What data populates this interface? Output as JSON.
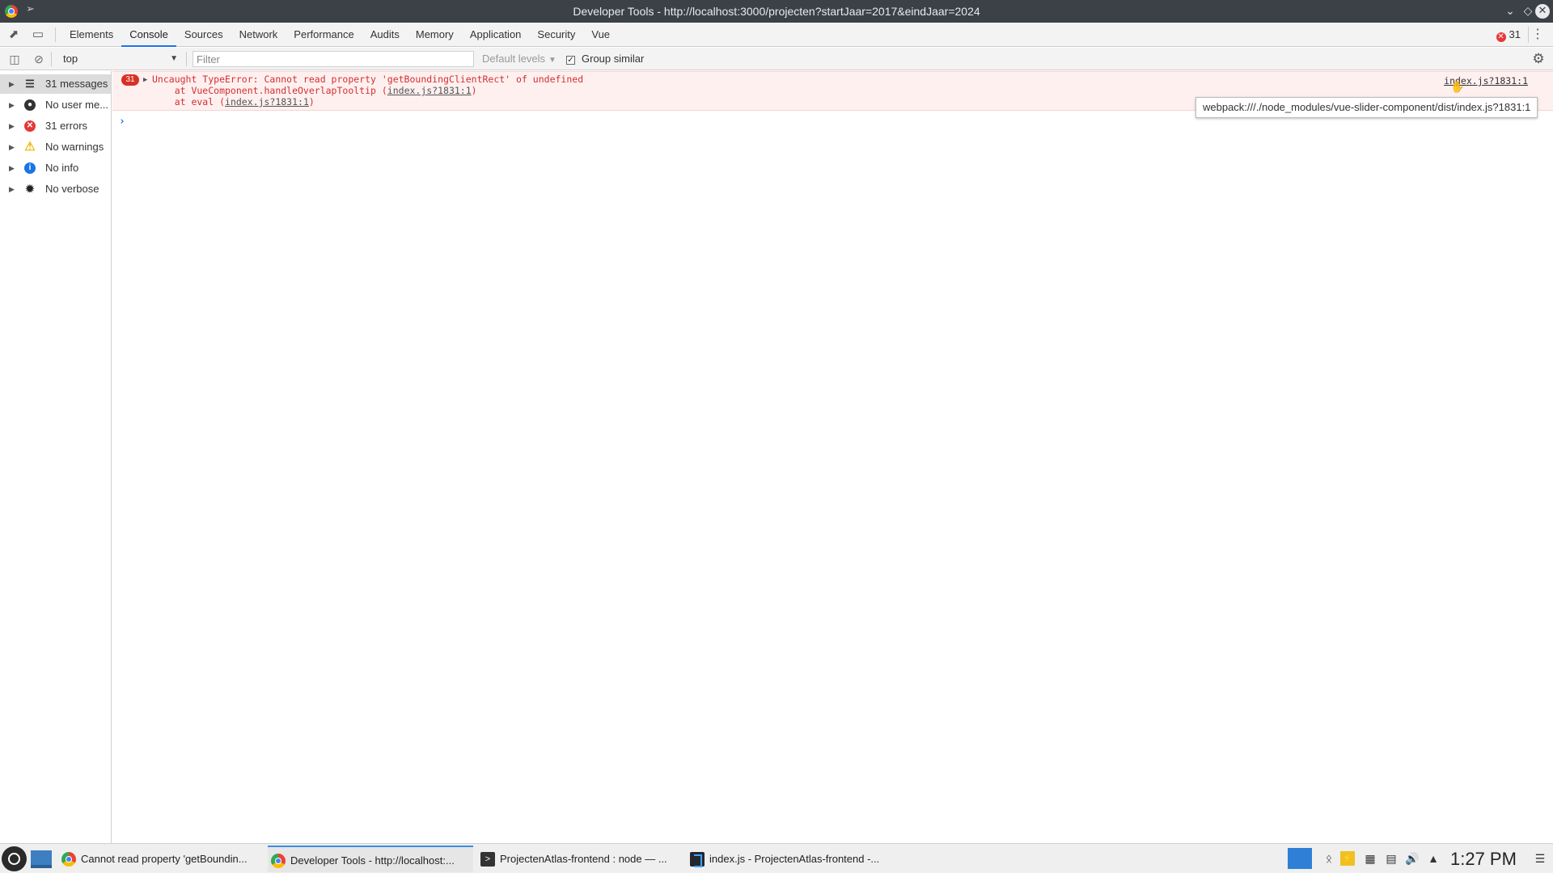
{
  "window": {
    "title": "Developer Tools - http://localhost:3000/projecten?startJaar=2017&eindJaar=2024"
  },
  "devtools": {
    "tabs": [
      "Elements",
      "Console",
      "Sources",
      "Network",
      "Performance",
      "Audits",
      "Memory",
      "Application",
      "Security",
      "Vue"
    ],
    "active_tab": "Console",
    "error_count": "31"
  },
  "console_toolbar": {
    "context": "top",
    "filter_placeholder": "Filter",
    "levels_label": "Default levels",
    "group_similar_label": "Group similar",
    "group_similar_checked": true
  },
  "sidebar": {
    "items": [
      {
        "label": "31 messages",
        "icon": "list-icon"
      },
      {
        "label": "No user me...",
        "icon": "user-icon"
      },
      {
        "label": "31 errors",
        "icon": "error-icon"
      },
      {
        "label": "No warnings",
        "icon": "warning-icon"
      },
      {
        "label": "No info",
        "icon": "info-icon"
      },
      {
        "label": "No verbose",
        "icon": "bug-icon"
      }
    ]
  },
  "console": {
    "message": {
      "repeat_count": "31",
      "line1": "Uncaught TypeError: Cannot read property 'getBoundingClientRect' of undefined",
      "line2_prefix": "    at VueComponent.handleOverlapTooltip (",
      "line2_link": "index.js?1831:1",
      "line2_suffix": ")",
      "line3_prefix": "    at eval (",
      "line3_link": "index.js?1831:1",
      "line3_suffix": ")",
      "source_link": "index.js?1831:1"
    },
    "prompt_symbol": "›",
    "tooltip": "webpack:///./node_modules/vue-slider-component/dist/index.js?1831:1"
  },
  "taskbar": {
    "tasks": [
      {
        "label": "Cannot read property 'getBoundin...",
        "icon": "chrome-icon"
      },
      {
        "label": "Developer Tools - http://localhost:...",
        "icon": "chrome-icon"
      },
      {
        "label": "ProjectenAtlas-frontend : node — ...",
        "icon": "terminal-icon"
      },
      {
        "label": "index.js - ProjectenAtlas-frontend -...",
        "icon": "vscode-icon"
      }
    ],
    "active_task": 1,
    "clock": "1:27 PM"
  }
}
